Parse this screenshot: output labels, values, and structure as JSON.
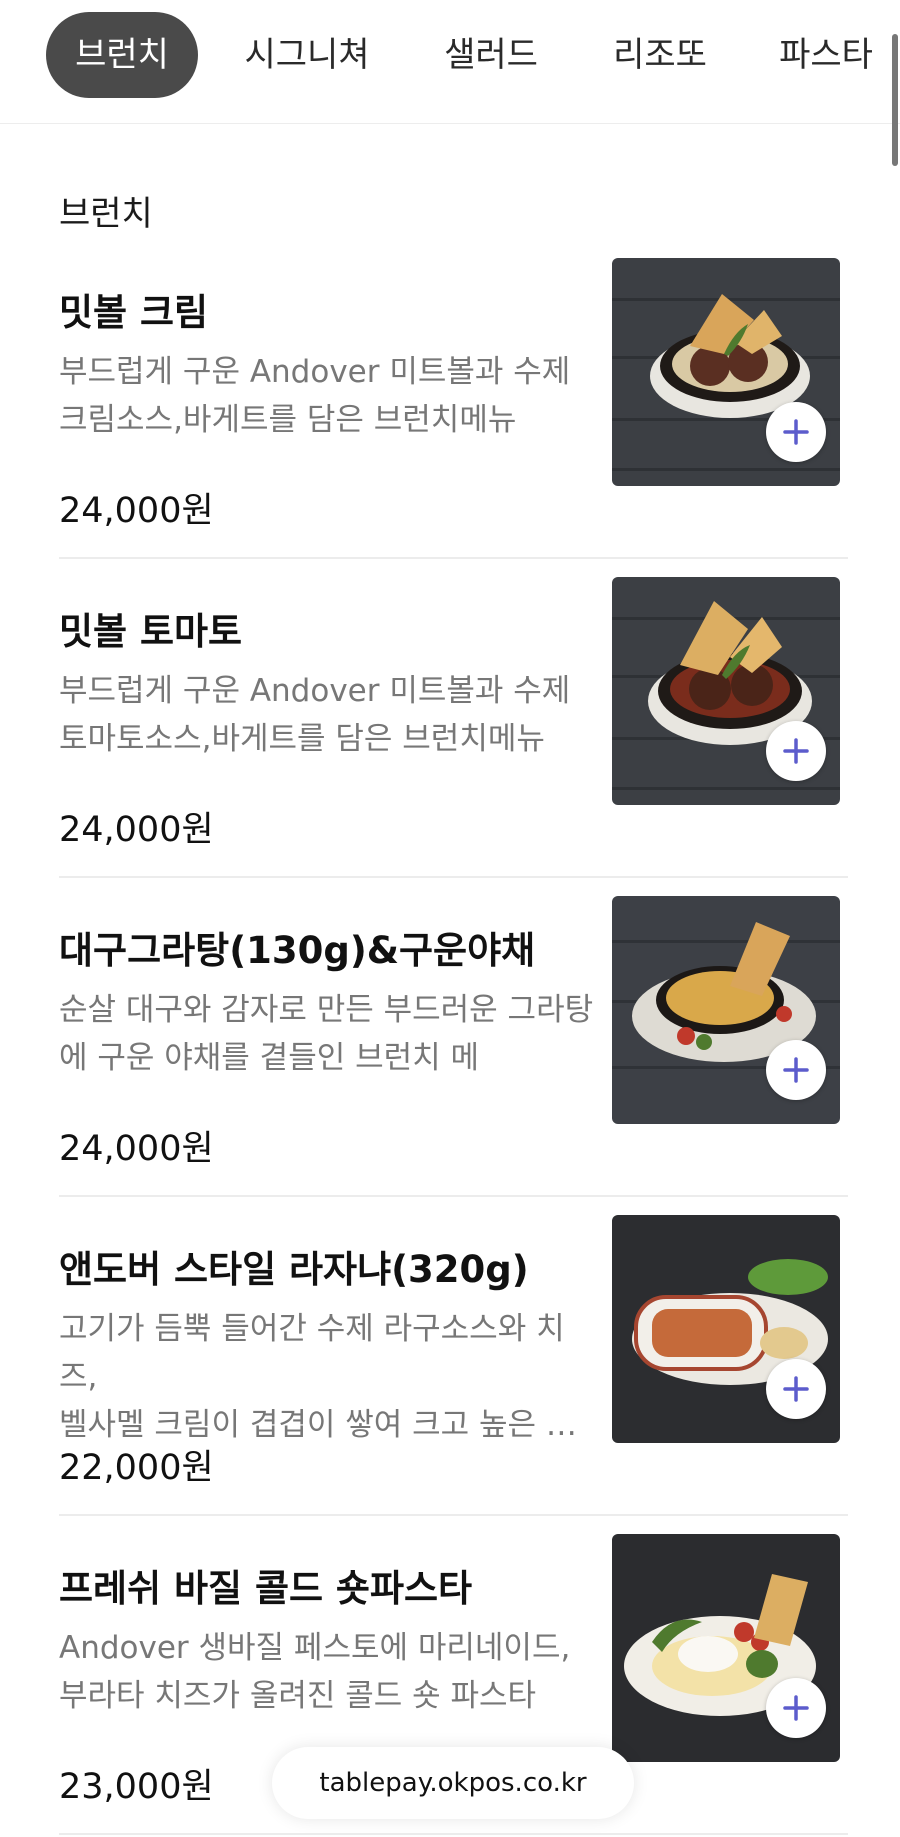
{
  "tabs": [
    {
      "label": "브런치",
      "active": true
    },
    {
      "label": "시그니쳐",
      "active": false
    },
    {
      "label": "샐러드",
      "active": false
    },
    {
      "label": "리조또",
      "active": false
    },
    {
      "label": "파스타",
      "active": false
    }
  ],
  "section": {
    "title": "브런치"
  },
  "items": [
    {
      "name": "밋볼 크림",
      "desc": "부드럽게 구운 Andover 미트볼과 수제\n크림소스,바게트를 담은 브런치메뉴",
      "price": "24,000원",
      "image_icon": "meatball-cream-photo"
    },
    {
      "name": "밋볼 토마토",
      "desc": "부드럽게 구운 Andover 미트볼과 수제\n토마토소스,바게트를 담은 브런치메뉴",
      "price": "24,000원",
      "image_icon": "meatball-tomato-photo"
    },
    {
      "name": "대구그라탕(130g)&구운야채",
      "desc": "순살 대구와 감자로 만든 부드러운 그라탕\n에 구운 야채를 곁들인 브런치 메",
      "price": "24,000원",
      "image_icon": "cod-gratin-photo"
    },
    {
      "name": "앤도버 스타일 라자냐(320g)",
      "desc": "고기가 듬뿍 들어간 수제 라구소스와 치즈,\n벨사멜 크림이 겹겹이 쌓여 크고 높은 …",
      "price": "22,000원",
      "image_icon": "lasagna-photo"
    },
    {
      "name": "프레쉬 바질 콜드 숏파스타",
      "desc": "Andover 생바질 페스토에 마리네이드,\n부라타 치즈가 올려진 콜드 숏 파스타",
      "price": "23,000원",
      "image_icon": "basil-pasta-photo"
    }
  ],
  "footer": {
    "url": "tablepay.okpos.co.kr"
  },
  "colors": {
    "active_tab": "#4a4a4a",
    "add_icon": "#5c5ccc",
    "desc_text": "#777777"
  }
}
